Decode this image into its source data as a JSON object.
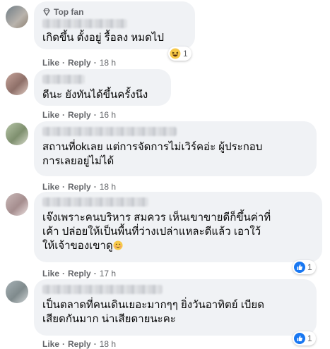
{
  "comments": [
    {
      "badge": "Top fan",
      "text": "เกิดขึ้น ตั้งอยู่ รื้อลง หมดไป",
      "like": "Like",
      "reply": "Reply",
      "time": "18 h",
      "reaction": {
        "icon": "haha-emoji",
        "count": "1"
      }
    },
    {
      "text": "ดีนะ ยังทันได้ขึ้นครั้งนึง",
      "like": "Like",
      "reply": "Reply",
      "time": "16 h"
    },
    {
      "text": "สถานที่okเลย แต่การจัดการไม่เวิร์คอ่ะ ผู้ประกอบ\nการเลยอยู่ไม่ได้",
      "like": "Like",
      "reply": "Reply",
      "time": "18 h"
    },
    {
      "text": "เจ๊งเพราะคนบริหาร สมควร เห็นเขาขายดีก็ขึ้นค่าที่\nเค้า ปล่อยให้เป็นพื้นที่ว่างเปล่าแหละดีแล้ว เอาใว้\nให้เจ้าของเขาดู",
      "like": "Like",
      "reply": "Reply",
      "time": "17 h",
      "reaction": {
        "icon": "like-emoji",
        "count": "1"
      }
    },
    {
      "text": "เป็นตลาดที่คนเดินเยอะมากๆๆ ยิ่งวันอาทิตย์ เบียด\nเสียดกันมาก น่าเสียดายนะคะ",
      "like": "Like",
      "reply": "Reply",
      "time": "18 h",
      "reaction": {
        "icon": "like-emoji",
        "count": "1"
      }
    }
  ],
  "colors": {
    "bubble": "#f0f2f5",
    "meta": "#65676b",
    "like_blue": "#1877f2"
  }
}
